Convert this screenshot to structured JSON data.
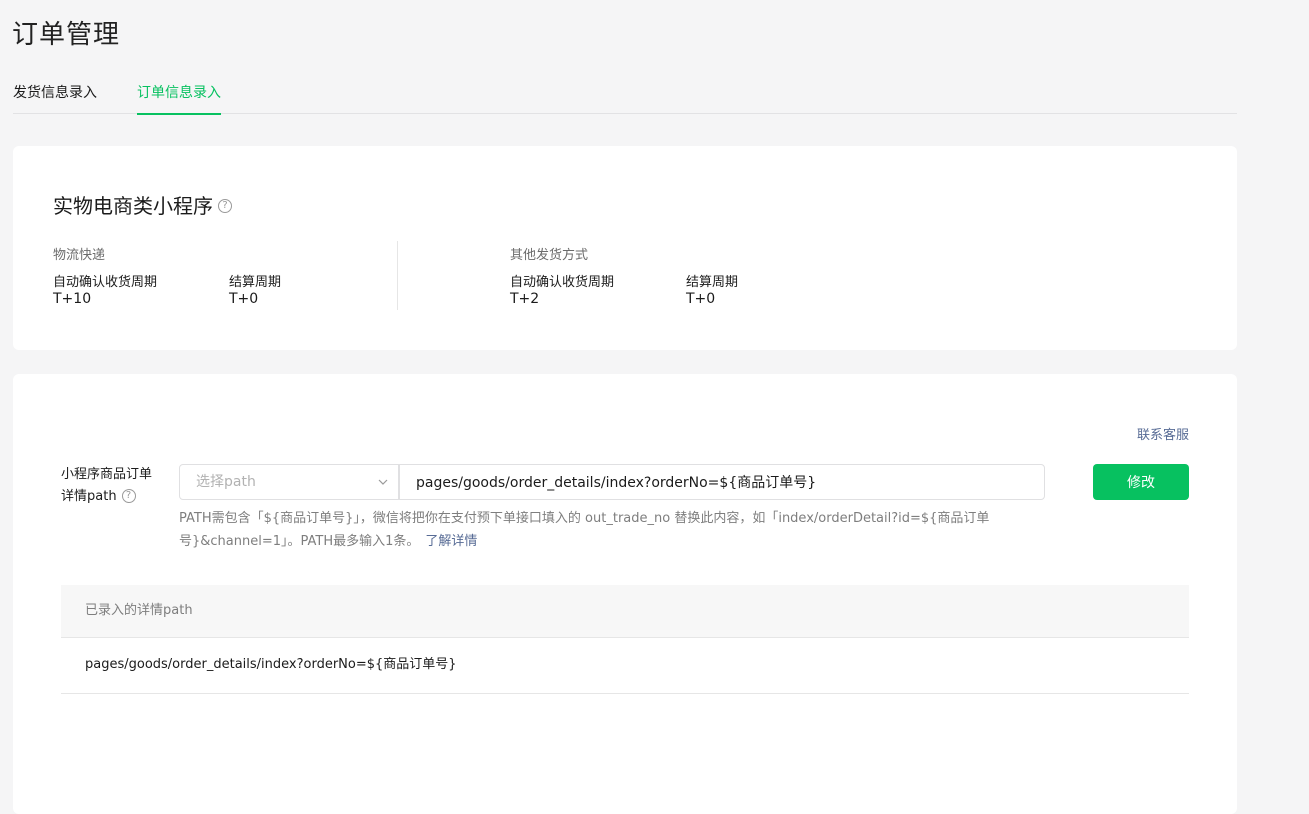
{
  "page_title": "订单管理",
  "tabs": [
    {
      "label": "发货信息录入",
      "active": false
    },
    {
      "label": "订单信息录入",
      "active": true
    }
  ],
  "category_card": {
    "title": "实物电商类小程序",
    "groups": [
      {
        "title": "物流快递",
        "items": [
          {
            "label": "自动确认收货周期",
            "value": "T+10"
          },
          {
            "label": "结算周期",
            "value": "T+0"
          }
        ]
      },
      {
        "title": "其他发货方式",
        "items": [
          {
            "label": "自动确认收货周期",
            "value": "T+2"
          },
          {
            "label": "结算周期",
            "value": "T+0"
          }
        ]
      }
    ]
  },
  "path_form": {
    "contact_link": "联系客服",
    "label_line1": "小程序商品订单",
    "label_line2": "详情path",
    "select_placeholder": "选择path",
    "path_value": "pages/goods/order_details/index?orderNo=${商品订单号}",
    "modify_button": "修改",
    "hint_text": "PATH需包含「${商品订单号}」，微信将把你在支付预下单接口填入的 out_trade_no 替换此内容，如「index/orderDetail?id=${商品订单号}&channel=1」。PATH最多输入1条。",
    "hint_link": "了解详情"
  },
  "path_table": {
    "header": "已录入的详情path",
    "rows": [
      "pages/goods/order_details/index?orderNo=${商品订单号}"
    ]
  },
  "colors": {
    "accent": "#07c160",
    "link": "#576b95",
    "background": "#f5f5f6"
  }
}
